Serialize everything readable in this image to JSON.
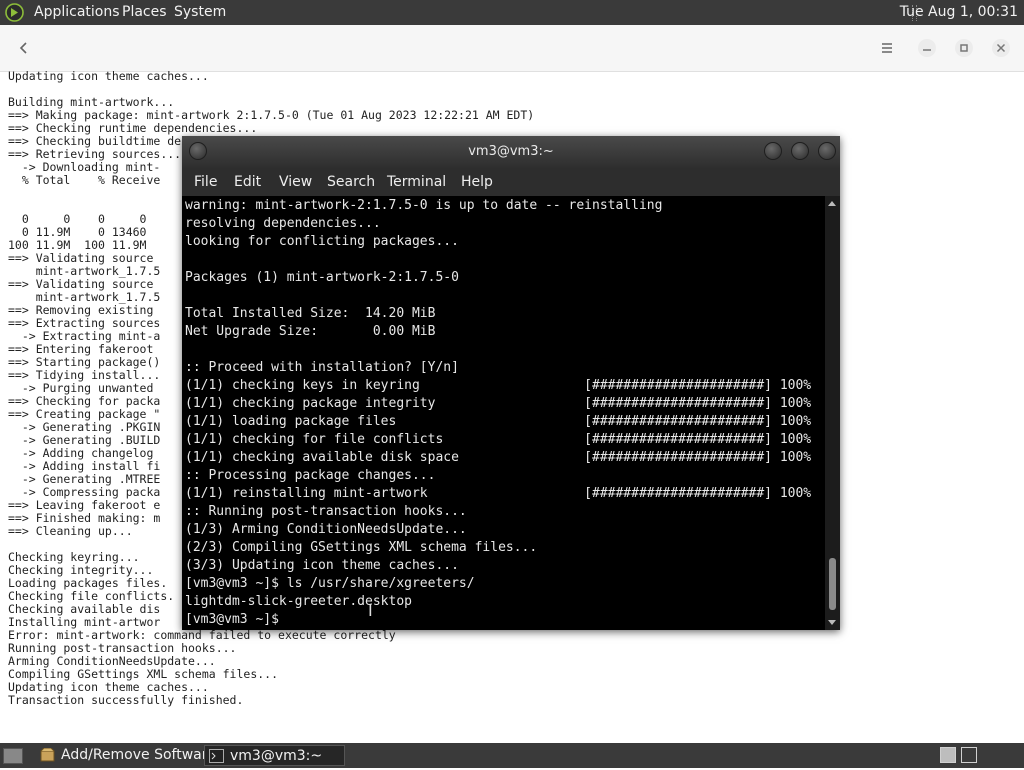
{
  "top_panel": {
    "menus": [
      "Applications",
      "Places",
      "System"
    ],
    "clock": "Tue Aug  1, 00:31"
  },
  "bg_window": {
    "icons": {
      "back": "back-arrow-icon",
      "menu": "hamburger-icon",
      "minimize": "minimize-icon",
      "maximize": "maximize-icon",
      "close": "close-icon"
    },
    "output": "Updating icon theme caches...\n\nBuilding mint-artwork...\n==> Making package: mint-artwork 2:1.7.5-0 (Tue 01 Aug 2023 12:22:21 AM EDT)\n==> Checking runtime dependencies...\n==> Checking buildtime dependencies...\n==> Retrieving sources...\n  -> Downloading mint-\n  % Total    % Receive\n\n\n  0     0    0     0\n  0 11.9M    0 13460\n100 11.9M  100 11.9M\n==> Validating source\n    mint-artwork_1.7.5\n==> Validating source\n    mint-artwork_1.7.5\n==> Removing existing\n==> Extracting sources\n  -> Extracting mint-a\n==> Entering fakeroot\n==> Starting package()\n==> Tidying install...\n  -> Purging unwanted\n==> Checking for packa\n==> Creating package \"\n  -> Generating .PKGIN\n  -> Generating .BUILD\n  -> Adding changelog\n  -> Adding install fi\n  -> Generating .MTREE\n  -> Compressing packa\n==> Leaving fakeroot e\n==> Finished making: m\n==> Cleaning up...\n\nChecking keyring...\nChecking integrity...\nLoading packages files.\nChecking file conflicts.\nChecking available dis\nInstalling mint-artwor\nError: mint-artwork: command failed to execute correctly\nRunning post-transaction hooks...\nArming ConditionNeedsUpdate...\nCompiling GSettings XML schema files...\nUpdating icon theme caches...\nTransaction successfully finished."
  },
  "terminal": {
    "title": "vm3@vm3:~",
    "menu": [
      "File",
      "Edit",
      "View",
      "Search",
      "Terminal",
      "Help"
    ],
    "output": "warning: mint-artwork-2:1.7.5-0 is up to date -- reinstalling\nresolving dependencies...\nlooking for conflicting packages...\n\nPackages (1) mint-artwork-2:1.7.5-0\n\nTotal Installed Size:  14.20 MiB\nNet Upgrade Size:       0.00 MiB\n\n:: Proceed with installation? [Y/n]\n(1/1) checking keys in keyring                     [######################] 100%\n(1/1) checking package integrity                   [######################] 100%\n(1/1) loading package files                        [######################] 100%\n(1/1) checking for file conflicts                  [######################] 100%\n(1/1) checking available disk space                [######################] 100%\n:: Processing package changes...\n(1/1) reinstalling mint-artwork                    [######################] 100%\n:: Running post-transaction hooks...\n(1/3) Arming ConditionNeedsUpdate...\n(2/3) Compiling GSettings XML schema files...\n(3/3) Updating icon theme caches...\n[vm3@vm3 ~]$ ls /usr/share/xgreeters/\nlightdm-slick-greeter.desktop\n[vm3@vm3 ~]$ "
  },
  "bottom_panel": {
    "tasks": [
      "Add/Remove Software",
      "vm3@vm3:~"
    ]
  }
}
